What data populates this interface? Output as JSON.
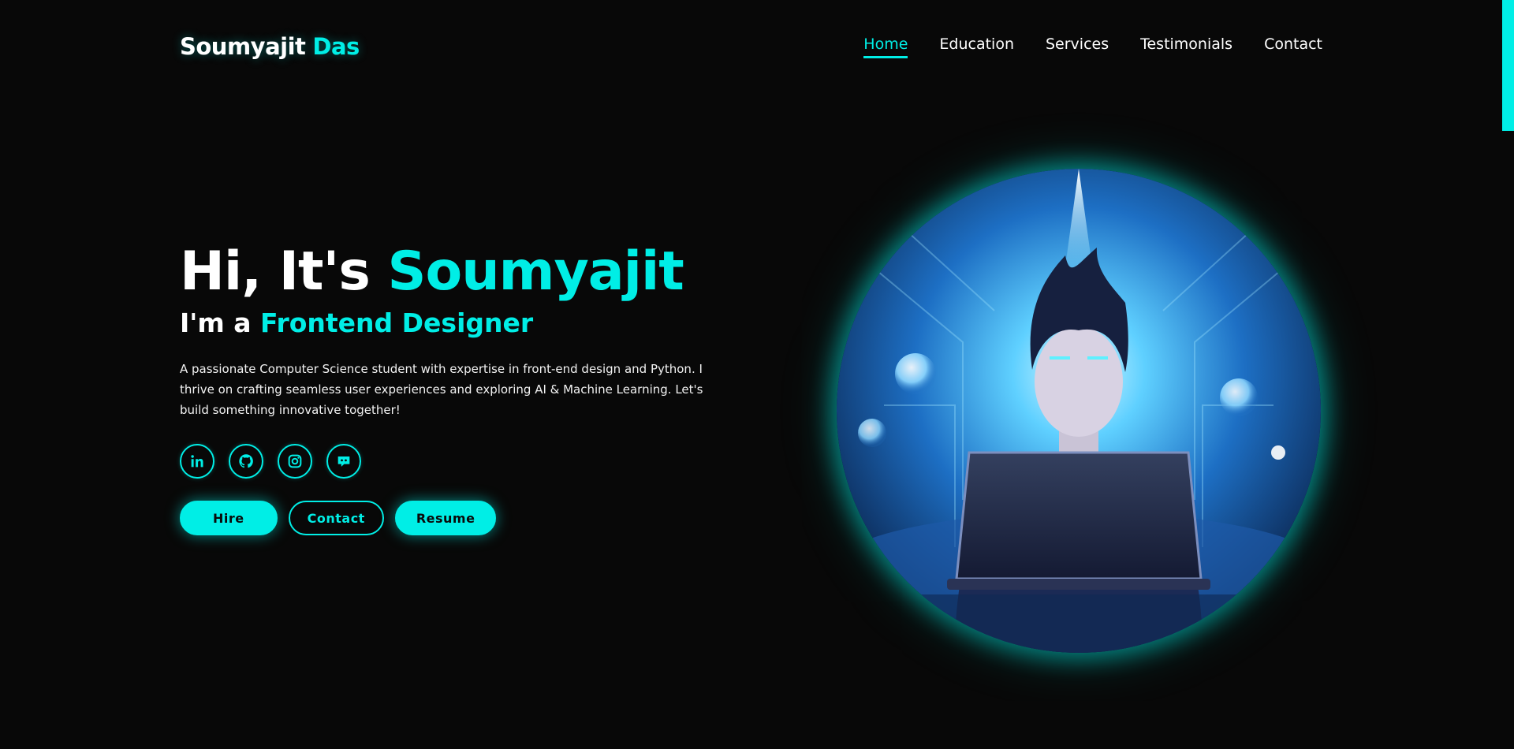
{
  "brand": {
    "first": "Soumyajit",
    "last": "Das"
  },
  "nav": [
    {
      "label": "Home",
      "active": true
    },
    {
      "label": "Education",
      "active": false
    },
    {
      "label": "Services",
      "active": false
    },
    {
      "label": "Testimonials",
      "active": false
    },
    {
      "label": "Contact",
      "active": false
    }
  ],
  "hero": {
    "greeting": "Hi, It's",
    "name": "Soumyajit",
    "role_prefix": "I'm a",
    "role": "Frontend Designer",
    "description": "A passionate Computer Science student with expertise in front-end design and Python. I thrive on crafting seamless user experiences and exploring AI & Machine Learning. Let's build something innovative together!"
  },
  "socials": [
    {
      "name": "linkedin-icon"
    },
    {
      "name": "github-icon"
    },
    {
      "name": "instagram-icon"
    },
    {
      "name": "discord-icon"
    }
  ],
  "buttons": {
    "hire": "Hire",
    "contact": "Contact",
    "resume": "Resume"
  },
  "colors": {
    "accent": "#00eee6",
    "background": "#080808",
    "text": "#ffffff"
  }
}
